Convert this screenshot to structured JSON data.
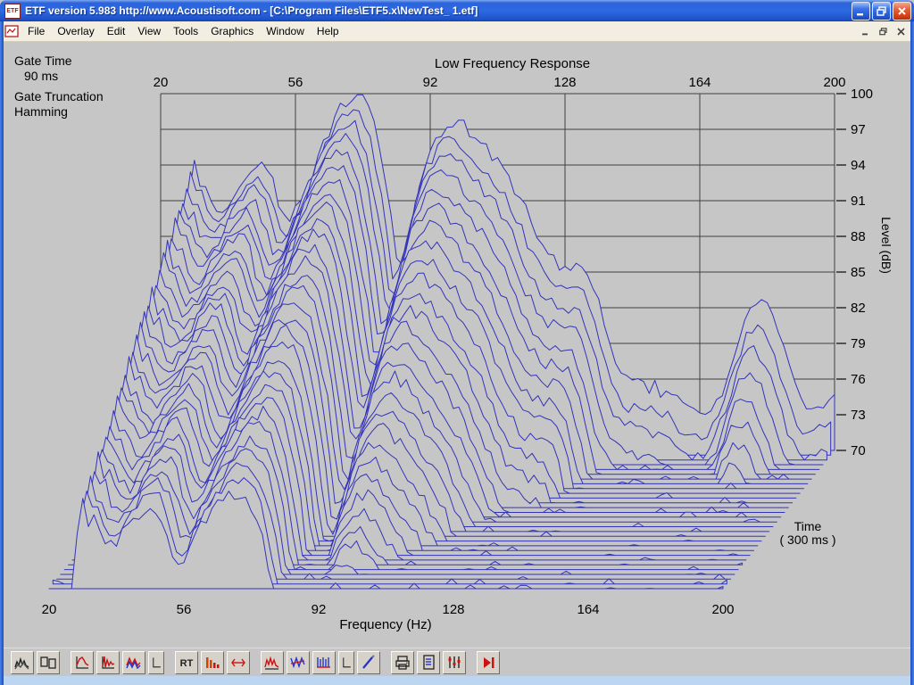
{
  "window": {
    "title": "ETF version 5.983 http://www.Acoustisoft.com - [C:\\Program Files\\ETF5.x\\NewTest_ 1.etf]",
    "icon_text": "ETF"
  },
  "menu": {
    "items": [
      "File",
      "Overlay",
      "Edit",
      "View",
      "Tools",
      "Graphics",
      "Window",
      "Help"
    ]
  },
  "plot": {
    "gate_time_label": "Gate Time",
    "gate_time_value": "90 ms",
    "gate_truncation_label": "Gate Truncation",
    "gate_truncation_value": "Hamming"
  },
  "chart_data": {
    "type": "line",
    "variant": "3d-waterfall",
    "title": "Low Frequency Response",
    "xlabel": "Frequency (Hz)",
    "ylabel": "Level (dB)",
    "zlabel": "Time",
    "z_annotation": "( 300 ms )",
    "xlim": [
      20,
      200
    ],
    "ylim": [
      70,
      100
    ],
    "x_ticks": [
      20,
      56,
      92,
      128,
      164,
      200
    ],
    "y_ticks": [
      100,
      97,
      94,
      91,
      88,
      85,
      82,
      79,
      76,
      73,
      70
    ],
    "num_slices": 30,
    "time_span_ms": 300,
    "grid": true,
    "line_color": "#3333bb",
    "background_color": "#c6c6c6",
    "gate_time": "90 ms",
    "gate_truncation": "Hamming",
    "base_spectrum_db": [
      [
        20,
        70
      ],
      [
        22,
        72
      ],
      [
        24,
        77
      ],
      [
        26,
        86
      ],
      [
        28,
        93
      ],
      [
        29,
        94
      ],
      [
        30,
        93.2
      ],
      [
        31,
        91.8
      ],
      [
        32,
        92.6
      ],
      [
        34,
        90.8
      ],
      [
        36,
        90.2
      ],
      [
        38,
        90.8
      ],
      [
        40,
        91.5
      ],
      [
        42,
        92.3
      ],
      [
        44,
        93.2
      ],
      [
        46,
        93.8
      ],
      [
        48,
        94
      ],
      [
        50,
        92.6
      ],
      [
        52,
        90.4
      ],
      [
        54,
        89.2
      ],
      [
        56,
        90.1
      ],
      [
        58,
        91.6
      ],
      [
        60,
        93
      ],
      [
        62,
        94.6
      ],
      [
        64,
        96.2
      ],
      [
        66,
        97.6
      ],
      [
        68,
        98.8
      ],
      [
        70,
        99.6
      ],
      [
        72,
        100
      ],
      [
        74,
        99.6
      ],
      [
        76,
        98.4
      ],
      [
        78,
        96
      ],
      [
        80,
        92.5
      ],
      [
        82,
        88.5
      ],
      [
        83,
        86.2
      ],
      [
        84,
        85.5
      ],
      [
        86,
        87.5
      ],
      [
        88,
        90.5
      ],
      [
        90,
        93
      ],
      [
        92,
        95
      ],
      [
        94,
        96.3
      ],
      [
        96,
        97.2
      ],
      [
        98,
        97.7
      ],
      [
        100,
        97.5
      ],
      [
        102,
        97
      ],
      [
        104,
        96.4
      ],
      [
        106,
        95.6
      ],
      [
        108,
        94.9
      ],
      [
        110,
        94.2
      ],
      [
        112,
        93.4
      ],
      [
        114,
        92.4
      ],
      [
        116,
        91.2
      ],
      [
        118,
        89.8
      ],
      [
        120,
        88.4
      ],
      [
        122,
        87.2
      ],
      [
        124,
        86.2
      ],
      [
        126,
        85.6
      ],
      [
        128,
        85.3
      ],
      [
        130,
        85.2
      ],
      [
        132,
        85.4
      ],
      [
        134,
        85
      ],
      [
        136,
        83.6
      ],
      [
        138,
        81.4
      ],
      [
        140,
        79
      ],
      [
        142,
        77
      ],
      [
        144,
        76
      ],
      [
        146,
        75.4
      ],
      [
        148,
        75.8
      ],
      [
        150,
        75.2
      ],
      [
        152,
        75.6
      ],
      [
        154,
        74.8
      ],
      [
        156,
        75.4
      ],
      [
        158,
        74.4
      ],
      [
        160,
        73.6
      ],
      [
        162,
        73.2
      ],
      [
        164,
        73
      ],
      [
        166,
        73.2
      ],
      [
        168,
        73.8
      ],
      [
        170,
        74.8
      ],
      [
        172,
        76.4
      ],
      [
        174,
        78.4
      ],
      [
        176,
        80.4
      ],
      [
        178,
        81.8
      ],
      [
        180,
        82.3
      ],
      [
        182,
        81.9
      ],
      [
        184,
        80.8
      ],
      [
        186,
        79
      ],
      [
        188,
        77
      ],
      [
        190,
        75.2
      ],
      [
        192,
        73.8
      ],
      [
        194,
        73.2
      ],
      [
        196,
        73.6
      ],
      [
        198,
        73.9
      ],
      [
        200,
        74.2
      ]
    ],
    "decay_db_per_slice": [
      [
        20,
        0.55
      ],
      [
        30,
        0.58
      ],
      [
        40,
        0.58
      ],
      [
        50,
        0.58
      ],
      [
        60,
        0.62
      ],
      [
        70,
        0.75
      ],
      [
        80,
        0.82
      ],
      [
        90,
        0.95
      ],
      [
        100,
        1.05
      ],
      [
        110,
        1.1
      ],
      [
        120,
        1.15
      ],
      [
        130,
        1.2
      ],
      [
        140,
        1.35
      ],
      [
        150,
        1.45
      ],
      [
        160,
        1.5
      ],
      [
        170,
        1.5
      ],
      [
        180,
        1.55
      ],
      [
        190,
        1.6
      ],
      [
        200,
        1.65
      ]
    ]
  },
  "toolbar": {
    "groups": [
      [
        {
          "name": "waterfall-view-button",
          "icon": "waterfall"
        },
        {
          "name": "dual-display-button",
          "icon": "dual-display"
        }
      ],
      [
        {
          "name": "frequency-response-button",
          "icon": "freq-response"
        },
        {
          "name": "impulse-response-button",
          "icon": "impulse-response"
        },
        {
          "name": "overlay-response-button",
          "icon": "overlay-response"
        },
        {
          "name": "axes-toggle-button",
          "icon": "mini-axes",
          "narrow": true
        }
      ],
      [
        {
          "name": "rt60-button",
          "icon": "rt60",
          "label": "RT"
        },
        {
          "name": "energy-spectrum-button",
          "icon": "energy-spectrum"
        },
        {
          "name": "time-window-button",
          "icon": "time-arrows"
        }
      ],
      [
        {
          "name": "distortion-button",
          "icon": "double-response"
        },
        {
          "name": "phase-response-button",
          "icon": "overlay-vv"
        },
        {
          "name": "comb-filter-button",
          "icon": "comb-filter"
        },
        {
          "name": "axes-toggle-2-button",
          "icon": "mini-axes",
          "narrow": true
        },
        {
          "name": "marker-pencil-button",
          "icon": "marker-pencil"
        }
      ],
      [
        {
          "name": "print-button",
          "icon": "printer"
        },
        {
          "name": "report-button",
          "icon": "report"
        },
        {
          "name": "signal-levels-button",
          "icon": "mixer"
        }
      ],
      [
        {
          "name": "measure-button",
          "icon": "play"
        }
      ]
    ]
  }
}
